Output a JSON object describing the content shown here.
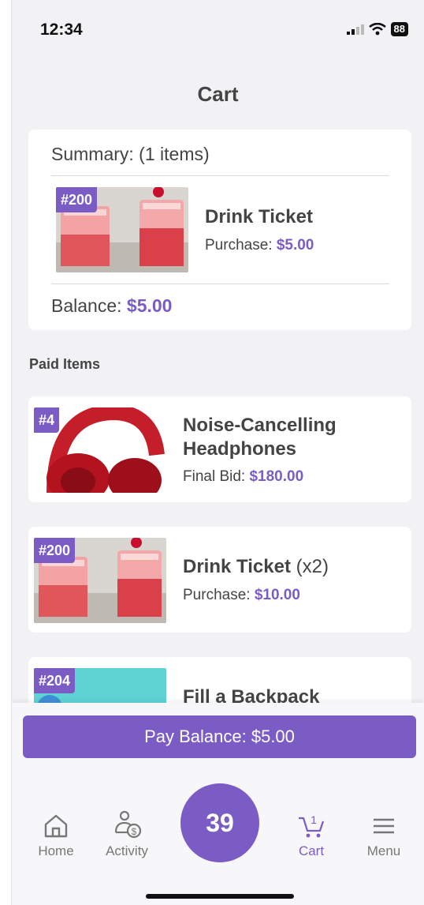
{
  "status": {
    "time": "12:34",
    "battery": "88"
  },
  "header": {
    "title": "Cart"
  },
  "summary": {
    "title": "Summary: (1 items)",
    "item": {
      "badge": "#200",
      "name": "Drink Ticket",
      "price_label": "Purchase:",
      "price": "$5.00"
    },
    "balance_label": "Balance:",
    "balance": "$5.00"
  },
  "paid": {
    "title": "Paid Items",
    "items": [
      {
        "badge": "#4",
        "name_line1": "Noise-Cancelling",
        "name_line2": "Headphones",
        "price_label": "Final Bid:",
        "price": "$180.00"
      },
      {
        "badge": "#200",
        "name": "Drink Ticket",
        "qty": "(x2)",
        "price_label": "Purchase:",
        "price": "$10.00"
      },
      {
        "badge": "#204",
        "name": "Fill a Backpack"
      }
    ]
  },
  "pay_button": {
    "label": "Pay Balance: $5.00"
  },
  "tabs": {
    "home": "Home",
    "activity": "Activity",
    "center": "39",
    "cart": "Cart",
    "cart_count": "1",
    "menu": "Menu"
  },
  "colors": {
    "accent": "#7b5cc4",
    "background": "#f2f2f5",
    "text": "#444444"
  }
}
